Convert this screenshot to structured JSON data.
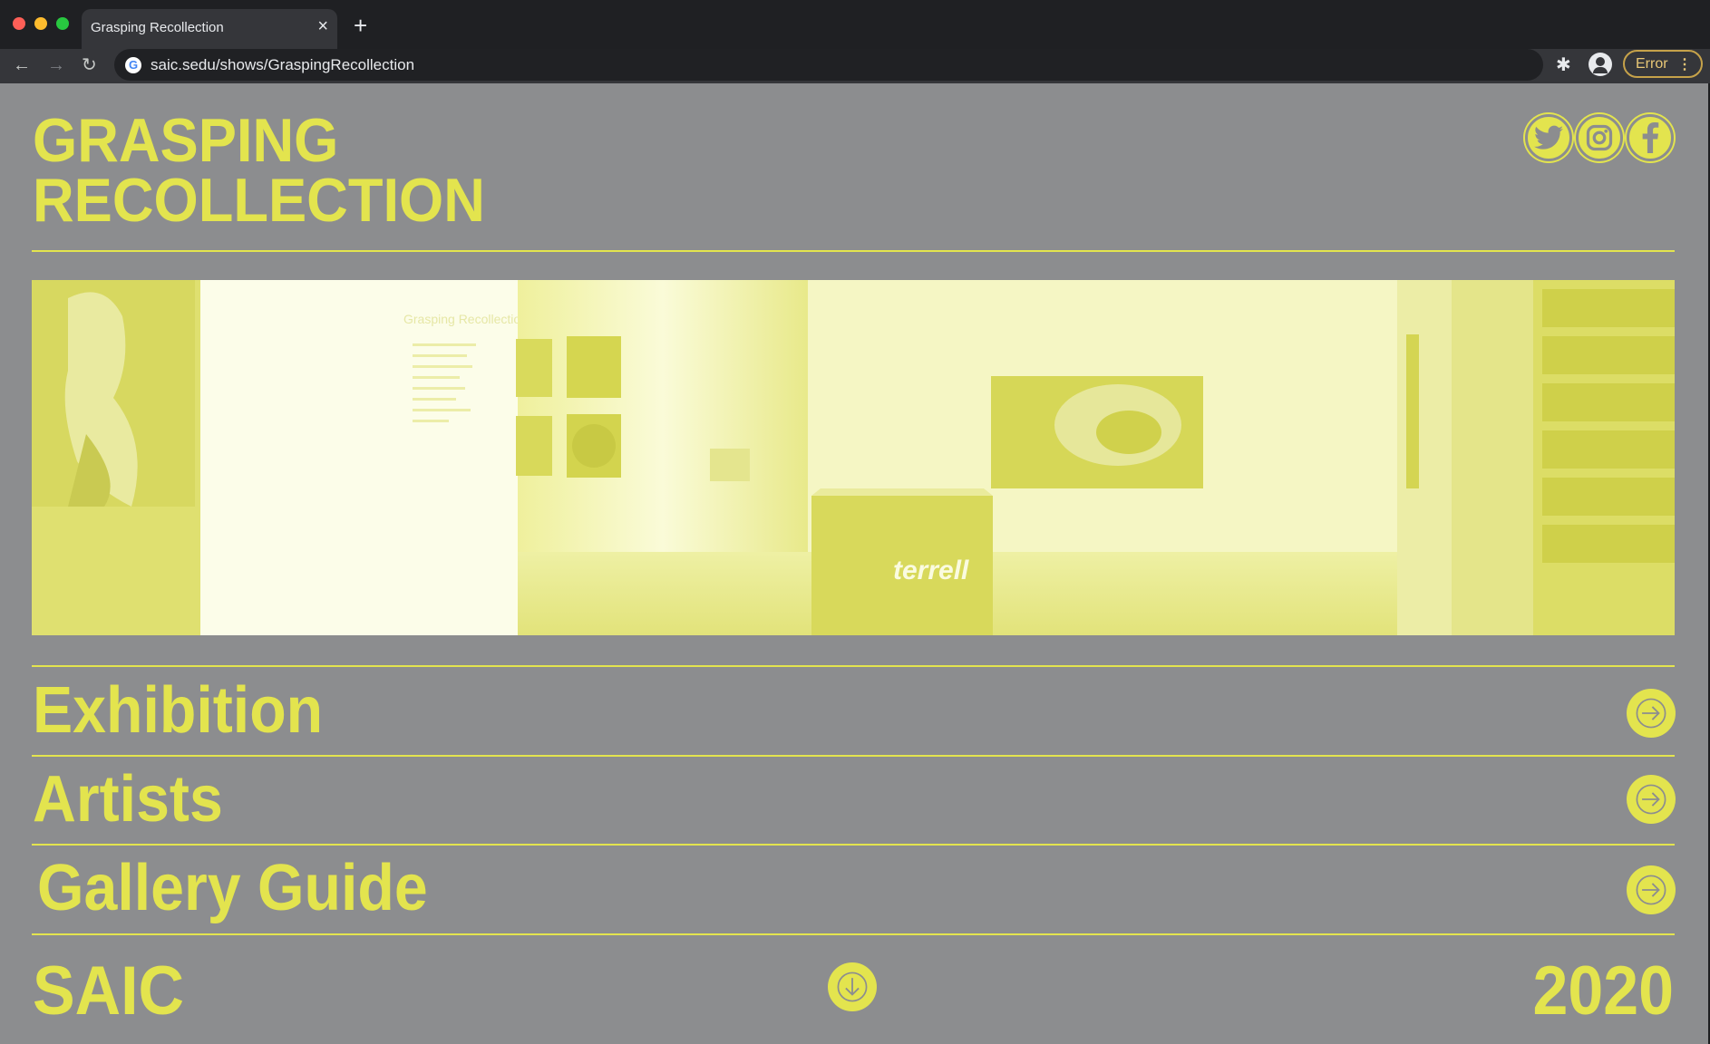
{
  "browser": {
    "tab_title": "Grasping Recollection",
    "close_glyph": "×",
    "new_tab_glyph": "+",
    "back_glyph": "←",
    "forward_glyph": "→",
    "reload_glyph": "↻",
    "url": "saic.sedu/shows/GraspingRecollection",
    "error_label": "Error",
    "menu_glyph": "⋮",
    "extensions_glyph": "✱",
    "icons": [
      "back-icon",
      "forward-icon",
      "reload-icon",
      "google-icon",
      "extensions-icon",
      "profile-icon",
      "menu-icon"
    ]
  },
  "header": {
    "title_line1": "GRASPING",
    "title_line2": "RECOLLECTION",
    "socials": [
      {
        "name": "twitter-icon"
      },
      {
        "name": "instagram-icon"
      },
      {
        "name": "facebook-icon"
      }
    ]
  },
  "hero": {
    "image": "gallery-panorama",
    "wall_text": "Grasping Recollection",
    "pedestal_text": "terrell"
  },
  "nav": [
    {
      "label": "Exhibition",
      "icon": "arrow-right-icon"
    },
    {
      "label": "Artists",
      "icon": "arrow-right-icon"
    },
    {
      "label": "Gallery Guide",
      "icon": "arrow-right-icon"
    }
  ],
  "footer": {
    "left": "SAIC",
    "right": "2020",
    "icon": "arrow-down-icon"
  },
  "colors": {
    "accent": "#e3e44e",
    "page_bg": "#8c8d8f",
    "chrome_dark": "#1f2023",
    "chrome_toolbar": "#35363a"
  }
}
